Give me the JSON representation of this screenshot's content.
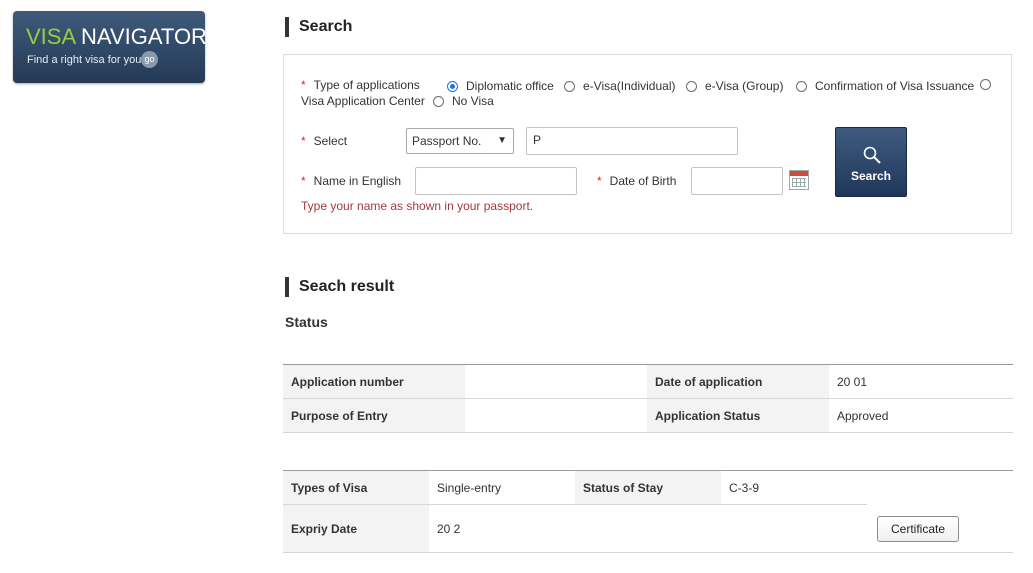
{
  "banner": {
    "title_part1": "VISA",
    "title_part2": " NAVIGATOR",
    "subtitle": "Find a right visa for you",
    "go_label": "go"
  },
  "search_section": {
    "heading": "Search",
    "type_label": "Type of applications",
    "application_types": [
      {
        "label": "Diplomatic office",
        "checked": true
      },
      {
        "label": "e-Visa(Individual)",
        "checked": false
      },
      {
        "label": "e-Visa (Group)",
        "checked": false
      },
      {
        "label": "Confirmation of Visa Issuance",
        "checked": false
      },
      {
        "label": "Visa Application Center",
        "checked": false
      },
      {
        "label": "No Visa",
        "checked": false
      }
    ],
    "select_label": "Select",
    "select_value": "Passport No.",
    "passport_value": "P",
    "name_label": "Name in English",
    "name_value": "",
    "dob_label": "Date of Birth",
    "dob_value": "",
    "hint": "Type your name as shown in your passport.",
    "search_button": "Search",
    "required_mark": "*"
  },
  "result_section": {
    "heading": "Seach result",
    "status_label": "Status",
    "summary": {
      "application_number_label": "Application number",
      "application_number_value": "",
      "date_of_application_label": "Date of application",
      "date_of_application_value": "20        01",
      "purpose_label": "Purpose of Entry",
      "purpose_value": "",
      "application_status_label": "Application Status",
      "application_status_value": "Approved"
    },
    "visa": {
      "types_label": "Types of Visa",
      "types_value": "Single-entry",
      "status_of_stay_label": "Status of Stay",
      "status_of_stay_value": "C-3-9",
      "expiry_label": "Expriy Date",
      "expiry_value": "20        2",
      "certificate_button": "Certificate"
    }
  },
  "colors": {
    "banner_bg": "#2e4868",
    "banner_accent": "#9ecb3b",
    "required": "#d0312d",
    "hint": "#a33a3a",
    "search_button_bg": "#2a4467"
  }
}
